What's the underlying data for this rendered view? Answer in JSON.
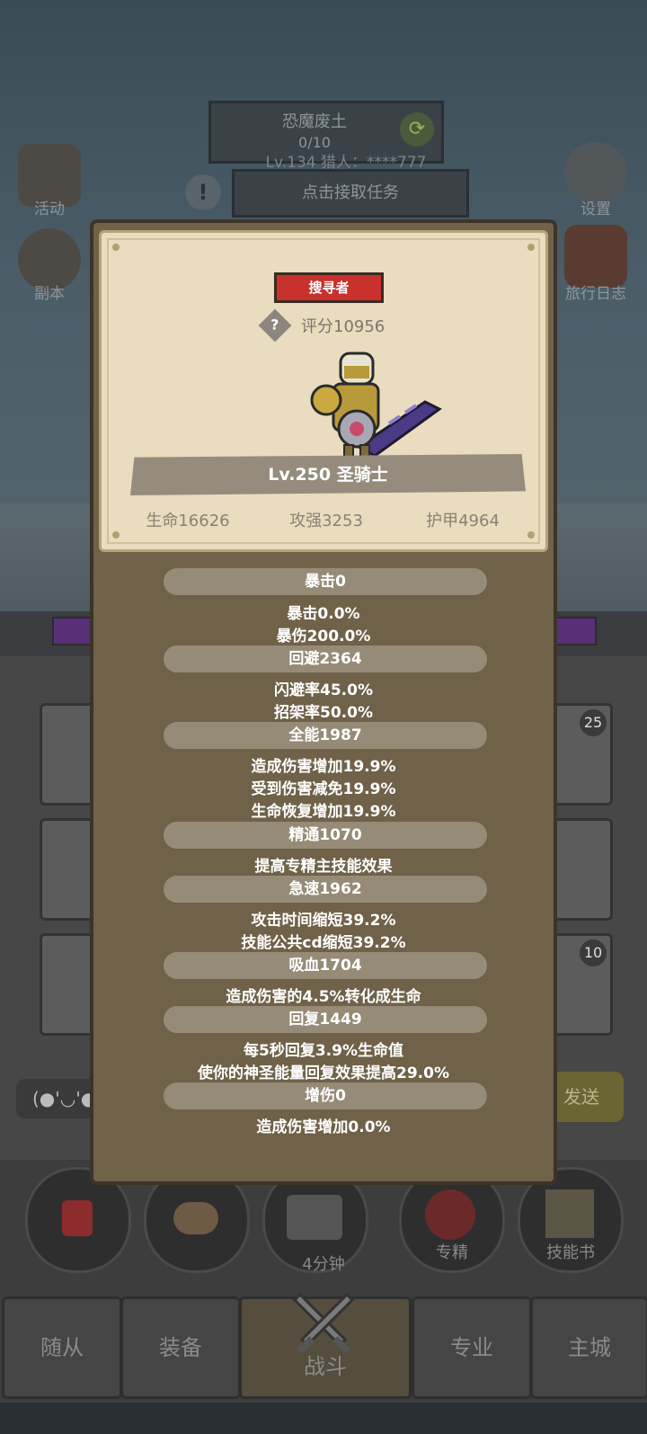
{
  "background": {
    "zone_name": "恐魔废土",
    "zone_progress": "0/10",
    "hunter_info": "Lv.134 猎人：****777",
    "task_button": "点击接取任务",
    "left_menu": [
      {
        "label": "活动",
        "icon": "scroll-icon"
      },
      {
        "label": "副本",
        "icon": "portal-icon"
      }
    ],
    "right_menu": [
      {
        "label": "设置",
        "icon": "gear-icon"
      },
      {
        "label": "旅行日志",
        "icon": "book-icon"
      }
    ],
    "slot_badges": [
      "25",
      "10"
    ],
    "chat_preview": "(●'◡'●",
    "send_label": "发送",
    "bottom_buttons": [
      {
        "label": "",
        "icon": "potion-icon"
      },
      {
        "label": "",
        "icon": "bread-icon"
      },
      {
        "label": "",
        "icon": "chest-icon"
      },
      {
        "label": "专精",
        "icon": "spec-icon"
      },
      {
        "label": "技能书",
        "icon": "skill-book-icon"
      }
    ],
    "timer": "4分钟",
    "nav_tabs": [
      "随从",
      "装备",
      "战斗",
      "专业",
      "主城"
    ],
    "active_tab": "战斗"
  },
  "modal": {
    "role_badge": "搜寻者",
    "score": "评分10956",
    "hero_name": "Lv.250 圣骑士",
    "hp": "生命16626",
    "attack": "攻强3253",
    "armor": "护甲4964",
    "attributes": [
      {
        "title": "暴击0",
        "lines": [
          "暴击0.0%",
          "暴伤200.0%"
        ]
      },
      {
        "title": "回避2364",
        "lines": [
          "闪避率45.0%",
          "招架率50.0%"
        ]
      },
      {
        "title": "全能1987",
        "lines": [
          "造成伤害增加19.9%",
          "受到伤害减免19.9%",
          "生命恢复增加19.9%"
        ]
      },
      {
        "title": "精通1070",
        "lines": [
          "提高专精主技能效果"
        ]
      },
      {
        "title": "急速1962",
        "lines": [
          "攻击时间缩短39.2%",
          "技能公共cd缩短39.2%"
        ]
      },
      {
        "title": "吸血1704",
        "lines": [
          "造成伤害的4.5%转化成生命"
        ]
      },
      {
        "title": "回复1449",
        "lines": [
          "每5秒回复3.9%生命值",
          "使你的神圣能量回复效果提高29.0%"
        ]
      },
      {
        "title": "增伤0",
        "lines": [
          "造成伤害增加0.0%"
        ]
      }
    ]
  }
}
